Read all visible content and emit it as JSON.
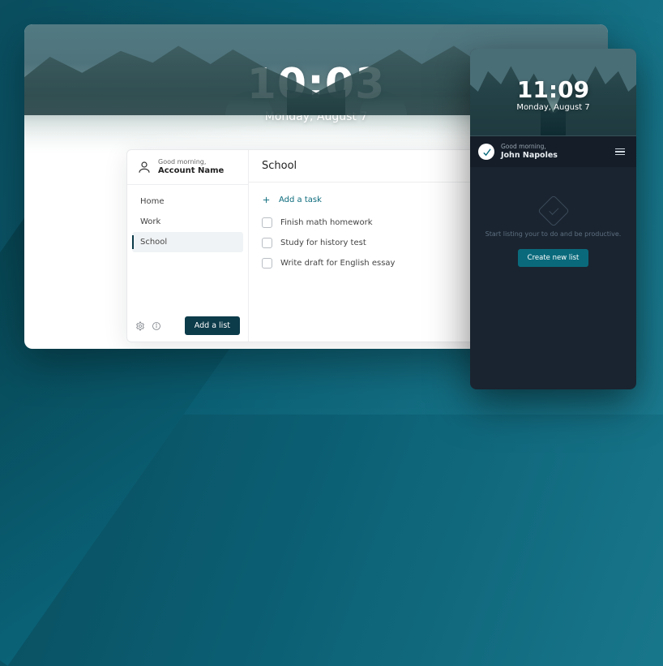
{
  "desktop": {
    "clock": "10:03",
    "date": "Monday, August 7",
    "greeting": "Good morning,",
    "account_name": "Account Name",
    "lists": [
      {
        "label": "Home",
        "active": false
      },
      {
        "label": "Work",
        "active": false
      },
      {
        "label": "School",
        "active": true
      }
    ],
    "add_list_label": "Add a list",
    "current_list_title": "School",
    "add_task_label": "Add a task",
    "tasks": [
      {
        "title": "Finish math homework"
      },
      {
        "title": "Study for history test"
      },
      {
        "title": "Write draft for English essay"
      }
    ]
  },
  "mobile": {
    "clock": "11:09",
    "date": "Monday, August 7",
    "greeting": "Good morning,",
    "user_name": "John Napoles",
    "empty_text": "Start listing your to do and be productive.",
    "cta_label": "Create new list"
  }
}
